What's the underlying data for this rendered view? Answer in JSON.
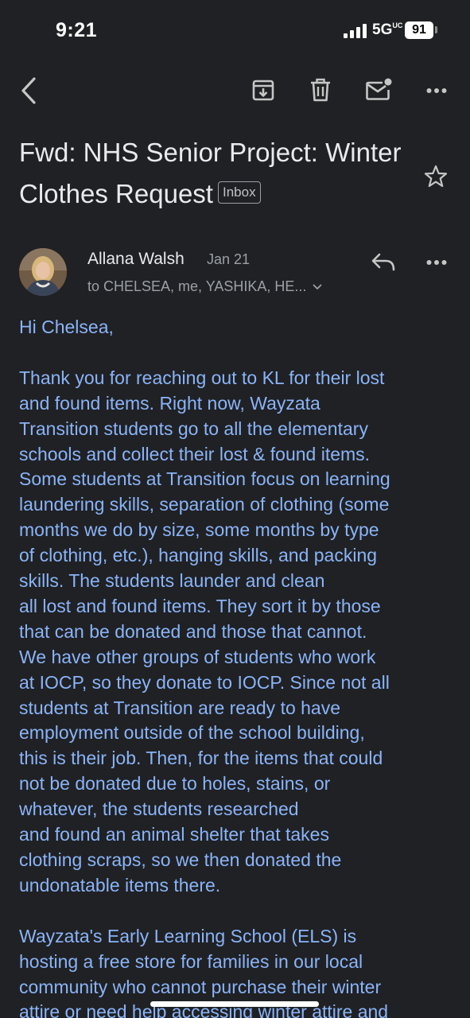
{
  "status_bar": {
    "time": "9:21",
    "network": "5G",
    "network_suffix": "UC",
    "battery": "91"
  },
  "toolbar": {
    "back_icon": "chevron-left-icon",
    "archive_icon": "archive-icon",
    "delete_icon": "trash-icon",
    "mark_unread_icon": "mail-unread-icon",
    "more_icon": "more-horizontal-icon"
  },
  "email": {
    "subject": "Fwd: NHS Senior Project: Winter Clothes Request",
    "label": "Inbox",
    "sender": {
      "name": "Allana Walsh",
      "date": "Jan 21",
      "recipients": "to CHELSEA, me, YASHIKA, HE..."
    },
    "greeting": "Hi Chelsea,",
    "paragraph1_lines": [
      "Thank you for reaching out to KL for their lost",
      "and found items. Right now, Wayzata",
      "Transition students go to all the elementary",
      "schools and collect their lost & found items.",
      "Some students at Transition focus on learning",
      "laundering skills, separation of clothing (some",
      "months we do by size, some months by type",
      "of clothing, etc.), hanging skills, and packing",
      "skills. The students launder and clean",
      "all lost and found items. They sort it by those",
      "that can be donated and those that cannot.",
      "We have other groups of students who work",
      "at IOCP, so they donate to IOCP. Since not all",
      "students at Transition are ready to have",
      "employment outside of the school building,",
      "this is their job. Then, for the items that could",
      "not be donated due to holes, stains, or",
      "whatever, the students researched",
      "and found an animal shelter that takes",
      "clothing scraps, so we then donated the",
      "undonatable items there."
    ],
    "paragraph2_lines": [
      "Wayzata's Early Learning School (ELS) is",
      "hosting a free store for families in our local",
      "community who cannot purchase their winter",
      "attire or need help accessing winter attire and"
    ]
  },
  "colors": {
    "background": "#202124",
    "link_text": "#8ab4f8",
    "primary_text": "#e8eaed",
    "secondary_text": "#9aa0a6"
  }
}
